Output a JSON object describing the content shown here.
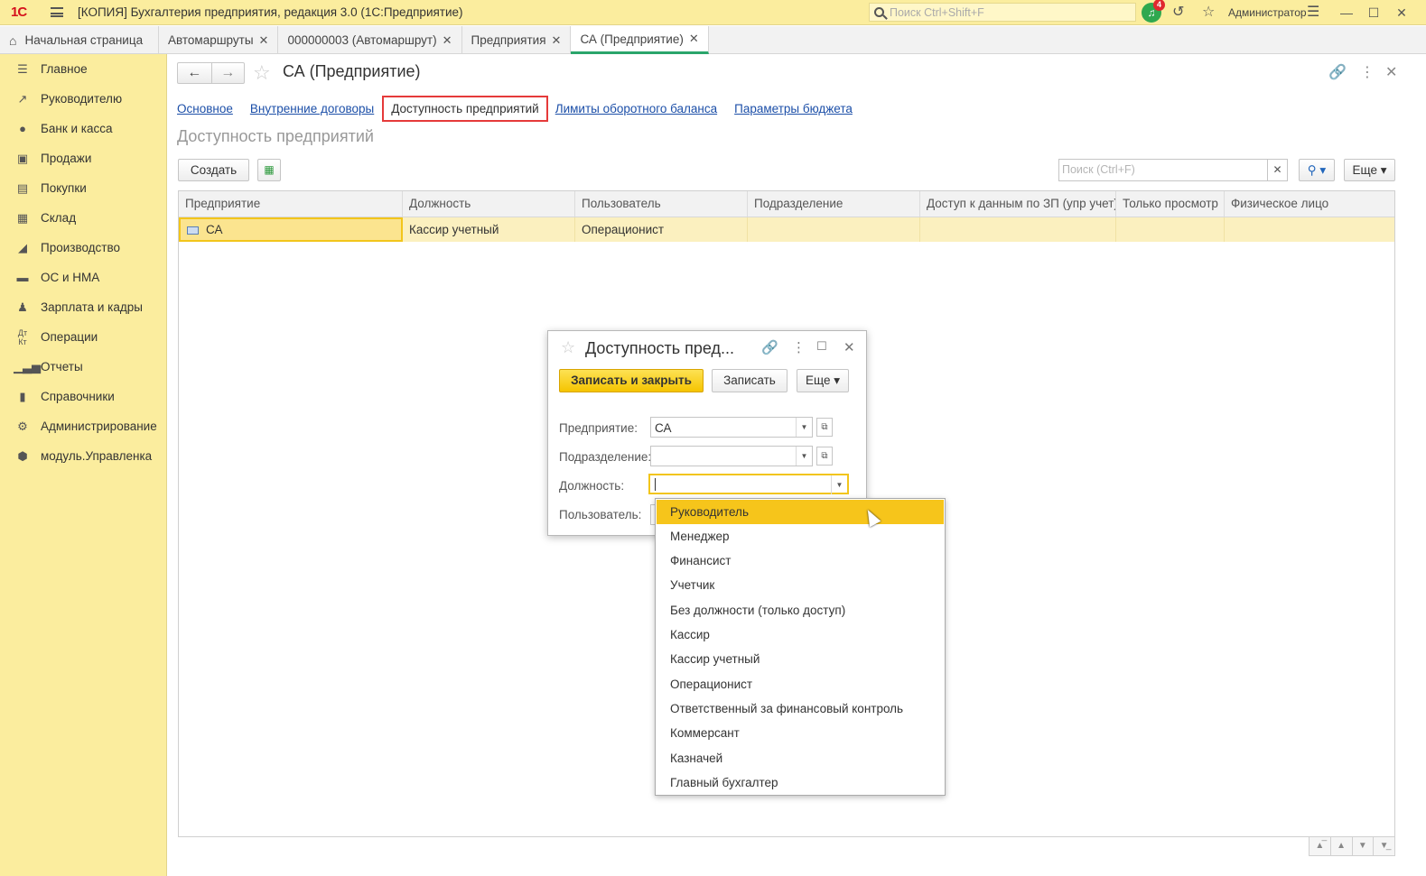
{
  "titlebar": {
    "logo": "1С",
    "title": "[КОПИЯ] Бухгалтерия предприятия, редакция 3.0  (1С:Предприятие)",
    "search_placeholder": "Поиск Ctrl+Shift+F",
    "notification_count": "4",
    "user": "Администратор"
  },
  "tabs": [
    {
      "label": "Начальная страница"
    },
    {
      "label": "Автомаршруты"
    },
    {
      "label": "000000003 (Автомаршрут)"
    },
    {
      "label": "Предприятия"
    },
    {
      "label": "СА (Предприятие)"
    }
  ],
  "sidebar": {
    "items": [
      {
        "label": "Главное",
        "icon": "menu-icon"
      },
      {
        "label": "Руководителю",
        "icon": "chart-trend-icon"
      },
      {
        "label": "Банк и касса",
        "icon": "coin-icon"
      },
      {
        "label": "Продажи",
        "icon": "bag-icon"
      },
      {
        "label": "Покупки",
        "icon": "cart-icon"
      },
      {
        "label": "Склад",
        "icon": "warehouse-icon"
      },
      {
        "label": "Производство",
        "icon": "factory-icon"
      },
      {
        "label": "ОС и НМА",
        "icon": "truck-icon"
      },
      {
        "label": "Зарплата и кадры",
        "icon": "person-icon"
      },
      {
        "label": "Операции",
        "icon": "dt-kt-icon"
      },
      {
        "label": "Отчеты",
        "icon": "bar-chart-icon"
      },
      {
        "label": "Справочники",
        "icon": "book-icon"
      },
      {
        "label": "Администрирование",
        "icon": "gear-icon"
      },
      {
        "label": "модуль.Управленка",
        "icon": "module-icon"
      }
    ]
  },
  "form": {
    "title": "СА (Предприятие)",
    "sublinks": [
      "Основное",
      "Внутренние договоры",
      "Доступность предприятий",
      "Лимиты оборотного баланса",
      "Параметры бюджета"
    ],
    "section_title": "Доступность предприятий",
    "create_label": "Создать",
    "search_placeholder": "Поиск (Ctrl+F)",
    "more_label": "Еще",
    "columns": [
      "Предприятие",
      "Должность",
      "Пользователь",
      "Подразделение",
      "Доступ к данным по ЗП (упр учет)",
      "Только просмотр",
      "Физическое лицо"
    ],
    "rows": [
      {
        "enterprise": "СА",
        "position": "Кассир учетный",
        "user": "Операционист",
        "department": "",
        "salary_access": "",
        "view_only": "",
        "person": ""
      }
    ]
  },
  "dialog": {
    "title": "Доступность пред...",
    "save_close_label": "Записать и закрыть",
    "save_label": "Записать",
    "more_label": "Еще",
    "fields": {
      "enterprise_label": "Предприятие:",
      "enterprise_value": "СА",
      "department_label": "Подразделение:",
      "department_value": "",
      "position_label": "Должность:",
      "position_value": "",
      "user_label": "Пользователь:"
    }
  },
  "dropdown": {
    "options": [
      "Руководитель",
      "Менеджер",
      "Финансист",
      "Учетчик",
      "Без должности (только доступ)",
      "Кассир",
      "Кассир учетный",
      "Операционист",
      "Ответственный за финансовый контроль",
      "Коммерсант",
      "Казначей",
      "Главный бухгалтер"
    ],
    "highlighted": "Руководитель"
  },
  "colors": {
    "shell": "#fbed9e",
    "accent": "#f6c51b",
    "selected_row": "#fbf0bf",
    "link": "#1c4fa8",
    "active_tab": "#2aa56b"
  }
}
